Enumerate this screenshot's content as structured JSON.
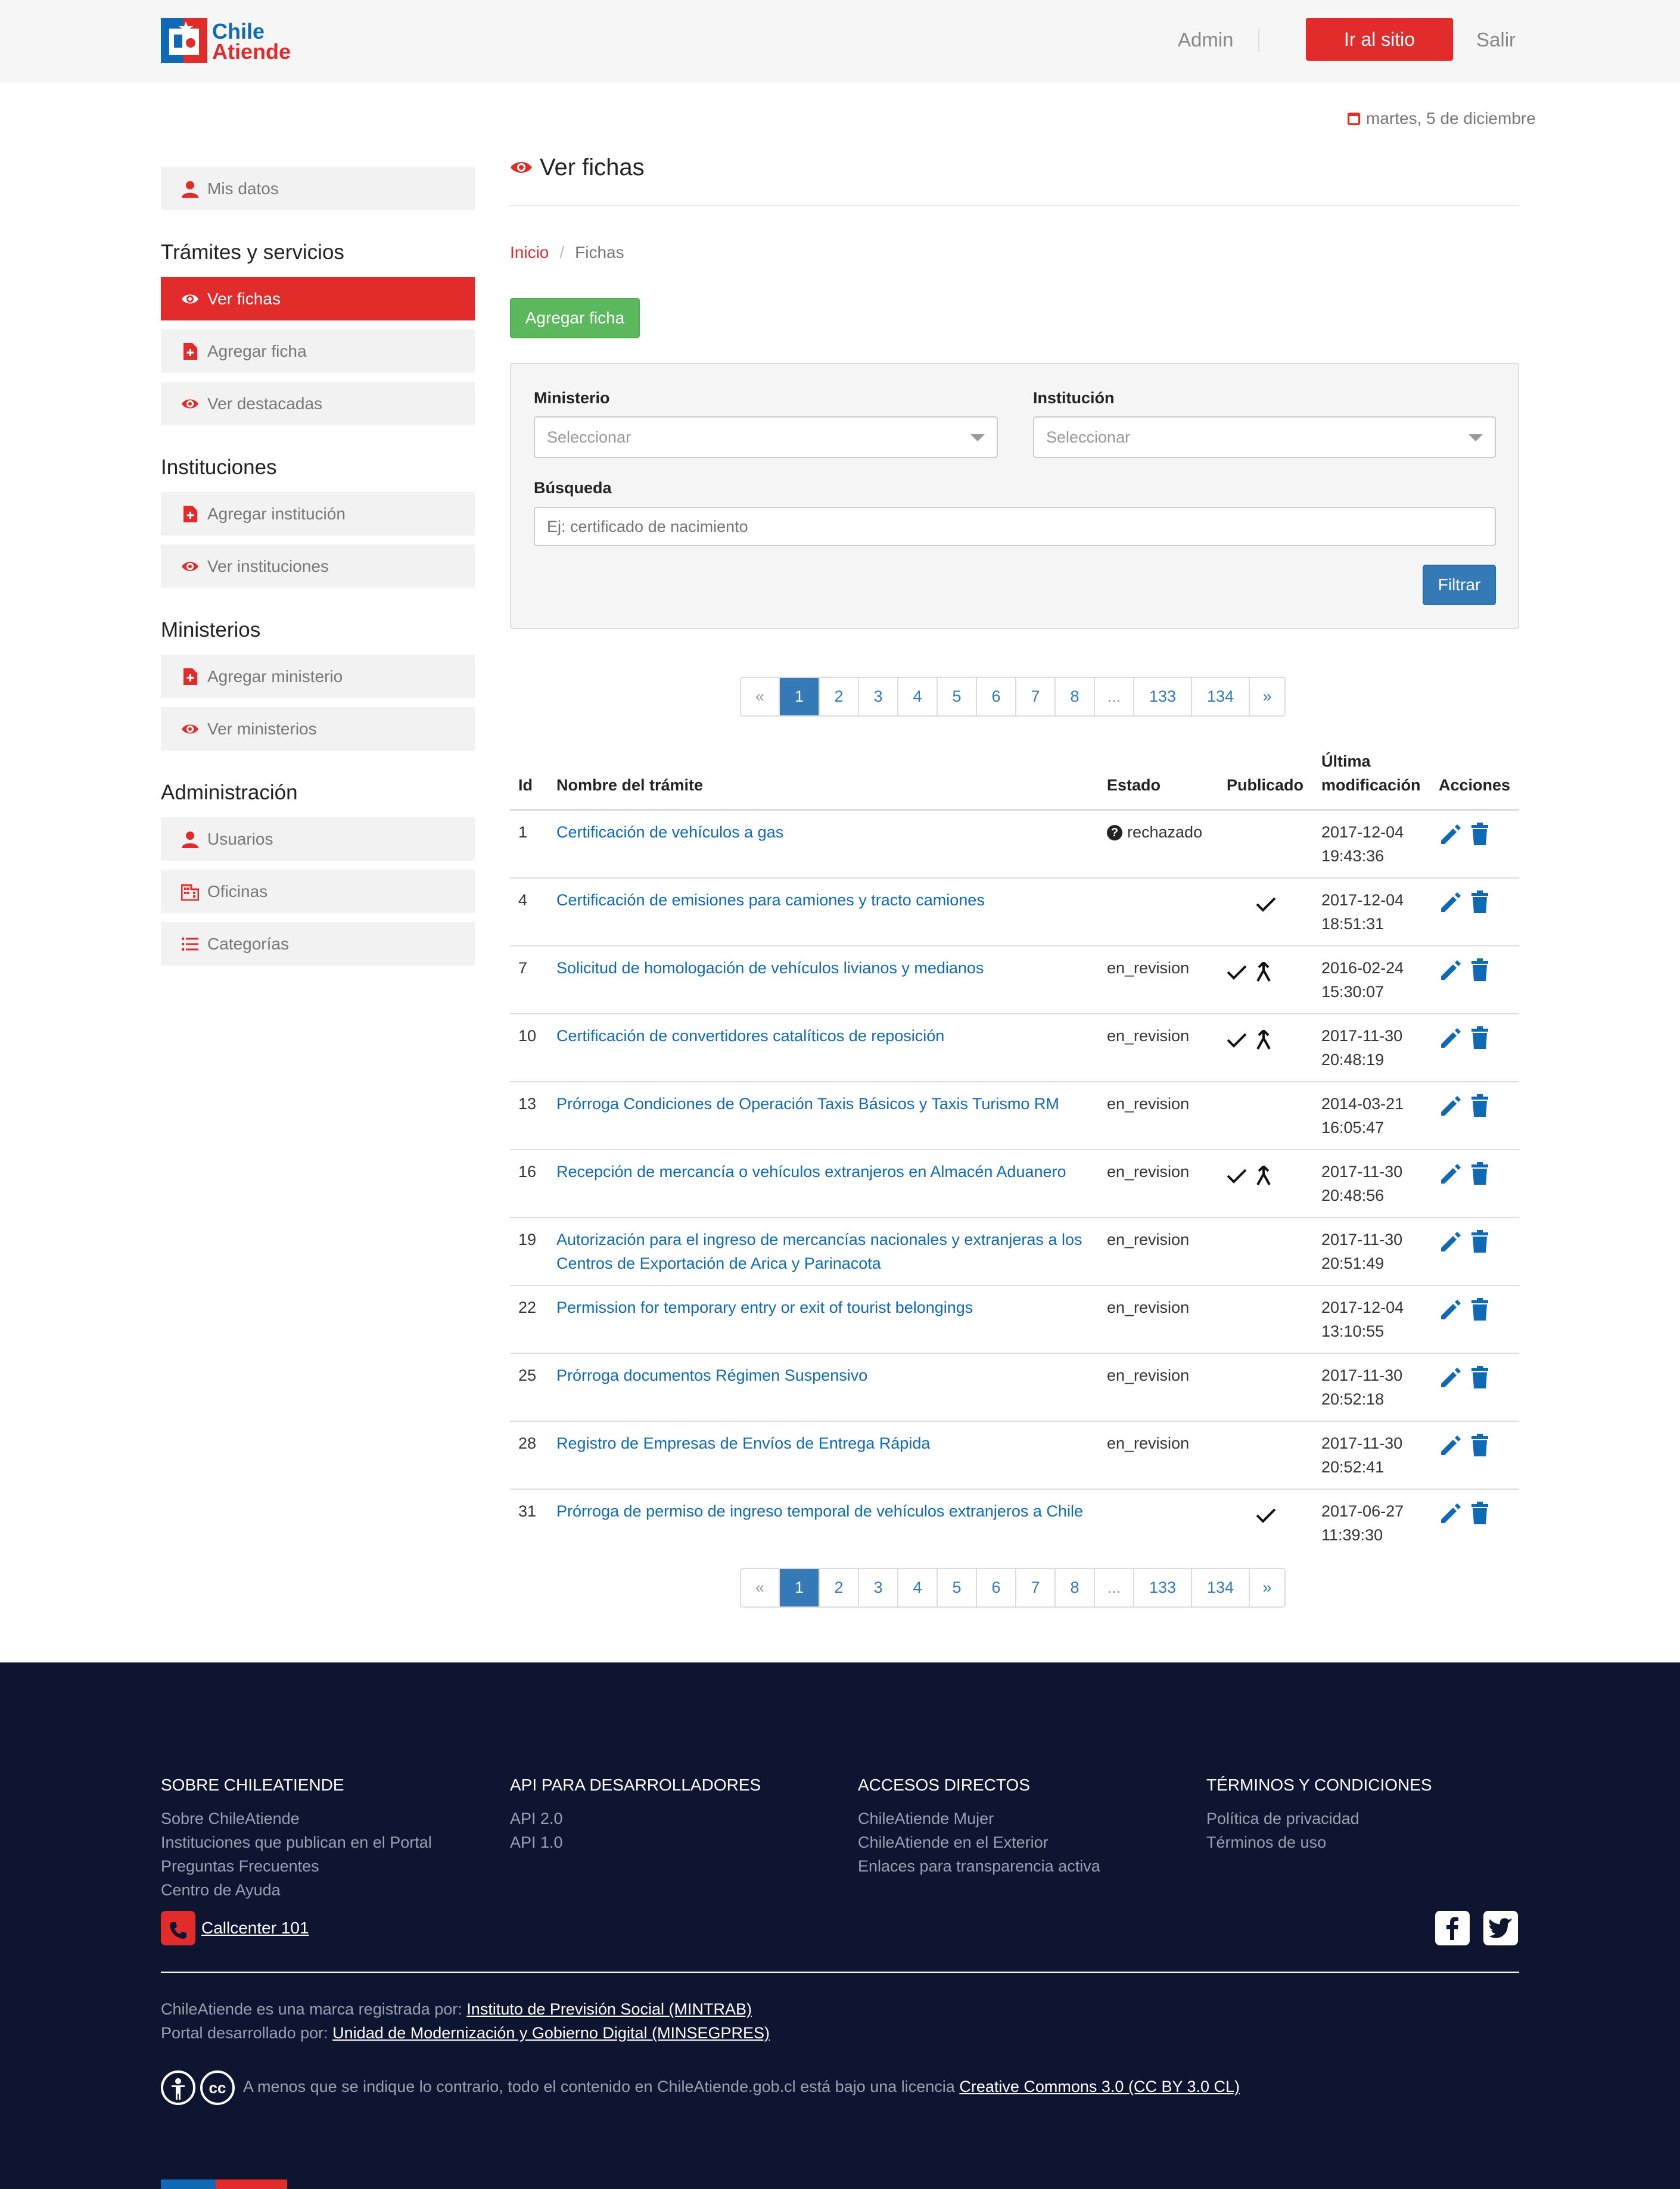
{
  "header": {
    "logo_line1": "Chile",
    "logo_line2": "Atiende",
    "admin_label": "Admin",
    "site_button": "Ir al sitio",
    "logout_label": "Salir"
  },
  "date_text": "martes, 5 de diciembre",
  "sidebar": {
    "my_data": "Mis datos",
    "sections": [
      {
        "title": "Trámites y servicios",
        "items": [
          "Ver fichas",
          "Agregar ficha",
          "Ver destacadas"
        ]
      },
      {
        "title": "Instituciones",
        "items": [
          "Agregar institución",
          "Ver instituciones"
        ]
      },
      {
        "title": "Ministerios",
        "items": [
          "Agregar ministerio",
          "Ver ministerios"
        ]
      },
      {
        "title": "Administración",
        "items": [
          "Usuarios",
          "Oficinas",
          "Categorías"
        ]
      }
    ]
  },
  "page": {
    "title": "Ver fichas",
    "breadcrumb_home": "Inicio",
    "breadcrumb_sep": "/",
    "breadcrumb_current": "Fichas",
    "add_button": "Agregar ficha"
  },
  "filter": {
    "ministry_label": "Ministerio",
    "ministry_value": "Seleccionar",
    "institution_label": "Institución",
    "institution_value": "Seleccionar",
    "search_label": "Búsqueda",
    "search_placeholder": "Ej: certificado de nacimiento",
    "filter_button": "Filtrar"
  },
  "pagination": {
    "prev": "«",
    "pages": [
      "1",
      "2",
      "3",
      "4",
      "5",
      "6",
      "7",
      "8",
      "...",
      "133",
      "134"
    ],
    "next": "»",
    "active": "1"
  },
  "table": {
    "headers": {
      "id": "Id",
      "name": "Nombre del trámite",
      "state": "Estado",
      "published": "Publicado",
      "modified_1": "Última",
      "modified_2": "modificación",
      "actions": "Acciones"
    },
    "rows": [
      {
        "id": "1",
        "name": "Certificación de vehículos a gas",
        "state": "rechazado",
        "published": false,
        "merge": false,
        "date": "2017-12-04",
        "time": "19:43:36"
      },
      {
        "id": "4",
        "name": "Certificación de emisiones para camiones y tracto camiones",
        "state": "",
        "published": true,
        "merge": false,
        "date": "2017-12-04",
        "time": "18:51:31"
      },
      {
        "id": "7",
        "name": "Solicitud de homologación de vehículos livianos y medianos",
        "state": "en_revision",
        "published": true,
        "merge": true,
        "date": "2016-02-24",
        "time": "15:30:07"
      },
      {
        "id": "10",
        "name": "Certificación de convertidores catalíticos de reposición",
        "state": "en_revision",
        "published": true,
        "merge": true,
        "date": "2017-11-30",
        "time": "20:48:19"
      },
      {
        "id": "13",
        "name": "Prórroga Condiciones de Operación Taxis Básicos y Taxis Turismo RM",
        "state": "en_revision",
        "published": false,
        "merge": false,
        "date": "2014-03-21",
        "time": "16:05:47"
      },
      {
        "id": "16",
        "name": "Recepción de mercancía o vehículos extranjeros en Almacén Aduanero",
        "state": "en_revision",
        "published": true,
        "merge": true,
        "date": "2017-11-30",
        "time": "20:48:56"
      },
      {
        "id": "19",
        "name": "Autorización para el ingreso de mercancías nacionales y extranjeras a los Centros de Exportación de Arica y Parinacota",
        "state": "en_revision",
        "published": false,
        "merge": false,
        "date": "2017-11-30",
        "time": "20:51:49"
      },
      {
        "id": "22",
        "name": "Permission for temporary entry or exit of tourist belongings",
        "state": "en_revision",
        "published": false,
        "merge": false,
        "date": "2017-12-04",
        "time": "13:10:55"
      },
      {
        "id": "25",
        "name": "Prórroga documentos Régimen Suspensivo",
        "state": "en_revision",
        "published": false,
        "merge": false,
        "date": "2017-11-30",
        "time": "20:52:18"
      },
      {
        "id": "28",
        "name": "Registro de Empresas de Envíos de Entrega Rápida",
        "state": "en_revision",
        "published": false,
        "merge": false,
        "date": "2017-11-30",
        "time": "20:52:41"
      },
      {
        "id": "31",
        "name": "Prórroga de permiso de ingreso temporal de vehículos extranjeros a Chile",
        "state": "",
        "published": true,
        "merge": false,
        "date": "2017-06-27",
        "time": "11:39:30"
      }
    ]
  },
  "footer": {
    "columns": [
      {
        "title": "SOBRE CHILEATIENDE",
        "links": [
          "Sobre ChileAtiende",
          "Instituciones que publican en el Portal",
          "Preguntas Frecuentes",
          "Centro de Ayuda"
        ]
      },
      {
        "title": "API PARA DESARROLLADORES",
        "links": [
          "API 2.0",
          "API 1.0"
        ]
      },
      {
        "title": "ACCESOS DIRECTOS",
        "links": [
          "ChileAtiende Mujer",
          "ChileAtiende en el Exterior",
          "Enlaces para transparencia activa"
        ]
      },
      {
        "title": "TÉRMINOS Y CONDICIONES",
        "links": [
          "Política de privacidad",
          "Términos de uso"
        ]
      }
    ],
    "callcenter": "Callcenter 101",
    "brand_prefix": "ChileAtiende es una marca registrada por:",
    "brand_link": "Instituto de Previsión Social (MINTRAB)",
    "dev_prefix": "Portal desarrollado por:",
    "dev_link": "Unidad de Modernización y Gobierno Digital (MINSEGPRES)",
    "license_prefix": "A menos que se indique lo contrario, todo el contenido en ChileAtiende.gob.cl está bajo una licencia",
    "license_link": "Creative Commons 3.0 (CC BY 3.0 CL)",
    "cc_badge": "cc"
  },
  "colors": {
    "brand_red": "#e22c2c",
    "brand_blue": "#0f69b4",
    "link_blue": "#337ab7",
    "success_green": "#5cb85c",
    "footer_bg": "#0d1530"
  }
}
